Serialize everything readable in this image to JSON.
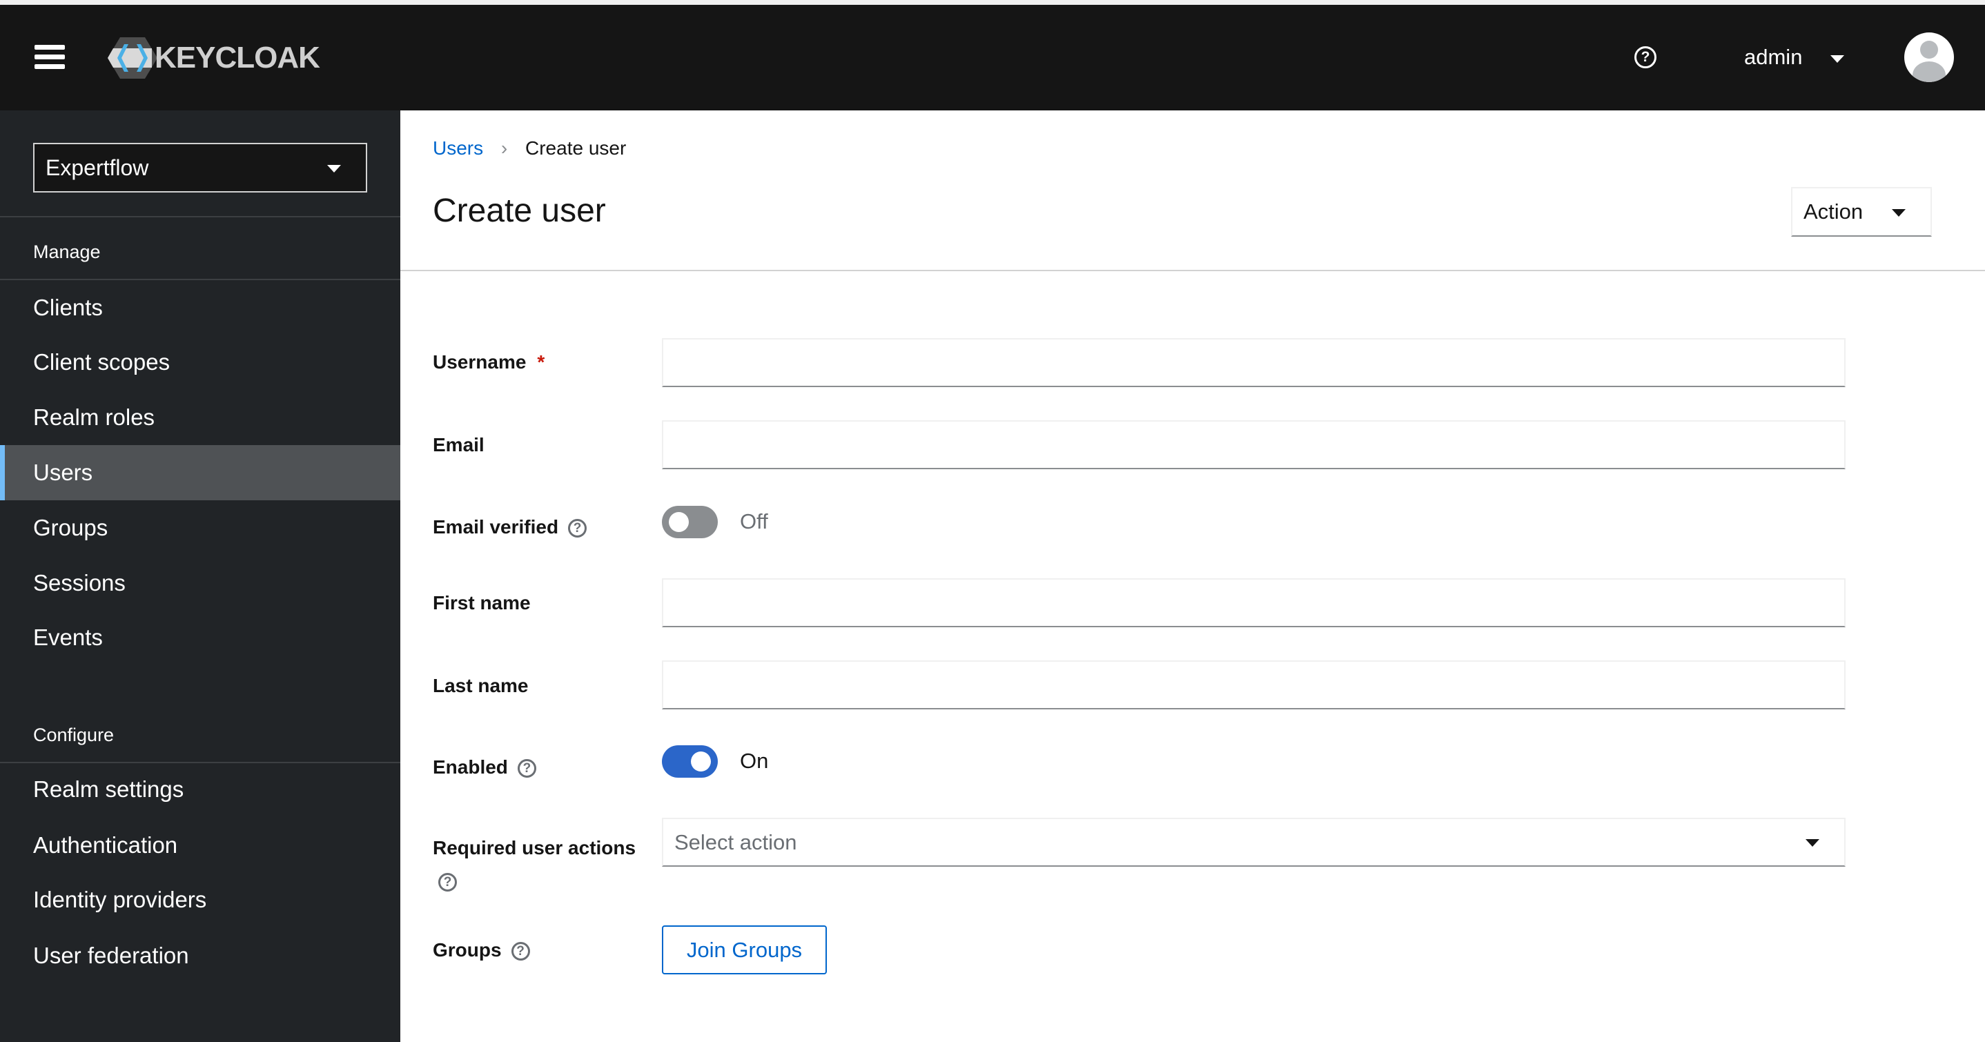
{
  "header": {
    "logo_text": "KEYCLOAK",
    "username": "admin"
  },
  "sidebar": {
    "realm": "Expertflow",
    "manage_label": "Manage",
    "configure_label": "Configure",
    "manage_items": [
      {
        "label": "Clients"
      },
      {
        "label": "Client scopes"
      },
      {
        "label": "Realm roles"
      },
      {
        "label": "Users"
      },
      {
        "label": "Groups"
      },
      {
        "label": "Sessions"
      },
      {
        "label": "Events"
      }
    ],
    "configure_items": [
      {
        "label": "Realm settings"
      },
      {
        "label": "Authentication"
      },
      {
        "label": "Identity providers"
      },
      {
        "label": "User federation"
      }
    ],
    "active": "Users"
  },
  "breadcrumb": {
    "parent": "Users",
    "current": "Create user"
  },
  "page": {
    "title": "Create user",
    "action_label": "Action"
  },
  "form": {
    "username_label": "Username",
    "required_mark": "*",
    "email_label": "Email",
    "email_verified_label": "Email verified",
    "email_verified_state": "Off",
    "first_name_label": "First name",
    "last_name_label": "Last name",
    "enabled_label": "Enabled",
    "enabled_state": "On",
    "required_actions_label": "Required user actions",
    "required_actions_placeholder": "Select action",
    "groups_label": "Groups",
    "join_groups_label": "Join Groups"
  },
  "colors": {
    "accent": "#2b66c9",
    "link": "#0066cc",
    "sidebar_bg": "#212427",
    "header_bg": "#151515"
  }
}
